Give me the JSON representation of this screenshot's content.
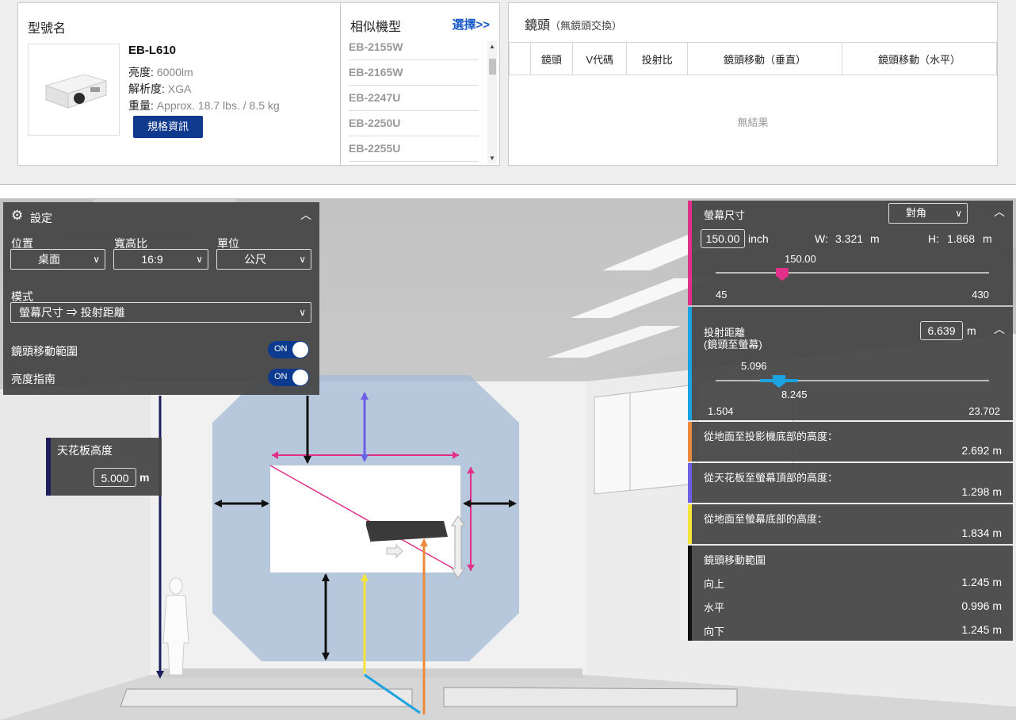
{
  "model": {
    "header": "型號名",
    "name": "EB-L610",
    "specs": [
      {
        "label": "亮度:",
        "value": "6000lm"
      },
      {
        "label": "解析度:",
        "value": "XGA"
      },
      {
        "label": "重量:",
        "value": "Approx. 18.7 lbs. / 8.5 kg"
      }
    ],
    "spec_button": "規格資訊"
  },
  "similar": {
    "header": "相似機型",
    "select_link": "選擇>>",
    "items": [
      "EB-2155W",
      "EB-2165W",
      "EB-2247U",
      "EB-2250U",
      "EB-2255U"
    ]
  },
  "lens": {
    "header": "鏡頭",
    "note": "（無鏡頭交換）",
    "columns": [
      "鏡頭",
      "V代碼",
      "投射比",
      "鏡頭移動（垂直）",
      "鏡頭移動（水平）"
    ],
    "empty": "無結果"
  },
  "settings": {
    "title": "設定",
    "position_label": "位置",
    "position_value": "桌面",
    "aspect_label": "寬高比",
    "aspect_value": "16:9",
    "unit_label": "單位",
    "unit_value": "公尺",
    "mode_label": "模式",
    "mode_value": "螢幕尺寸 ⇒ 投射距離",
    "lens_shift_label": "鏡頭移動範圍",
    "lens_shift_toggle": "ON",
    "brightness_label": "亮度指南",
    "brightness_toggle": "ON"
  },
  "ceiling": {
    "label": "天花板高度",
    "value": "5.000",
    "unit": "m"
  },
  "screen_size": {
    "title": "螢幕尺寸",
    "mode": "對角",
    "value": "150.00",
    "unit": "inch",
    "w_label": "W:",
    "w_value": "3.321",
    "h_label": "H:",
    "h_value": "1.868",
    "m": "m",
    "slider_value": "150.00",
    "slider_fraction": 0.243,
    "min": "45",
    "max": "430",
    "accent": "#e0308a"
  },
  "throw": {
    "title": "投射距離",
    "subtitle": "(鏡頭至螢幕)",
    "value": "6.639",
    "unit": "m",
    "range_low": "5.096",
    "range_high": "8.245",
    "min": "1.504",
    "max": "23.702",
    "slider_fraction": 0.231,
    "accent": "#1aa3e0"
  },
  "heights": [
    {
      "label": "從地面至投影機底部的高度：",
      "value": "2.692 m",
      "accent": "#ea8a3d"
    },
    {
      "label": "從天花板至螢幕頂部的高度：",
      "value": "1.298 m",
      "accent": "#6b5fe6"
    },
    {
      "label": "從地面至螢幕底部的高度：",
      "value": "1.834 m",
      "accent": "#f5e43a"
    }
  ],
  "shift": {
    "title": "鏡頭移動範圍",
    "rows": [
      {
        "label": "向上",
        "value": "1.245 m"
      },
      {
        "label": "水平",
        "value": "0.996 m"
      },
      {
        "label": "向下",
        "value": "1.245 m"
      }
    ]
  }
}
